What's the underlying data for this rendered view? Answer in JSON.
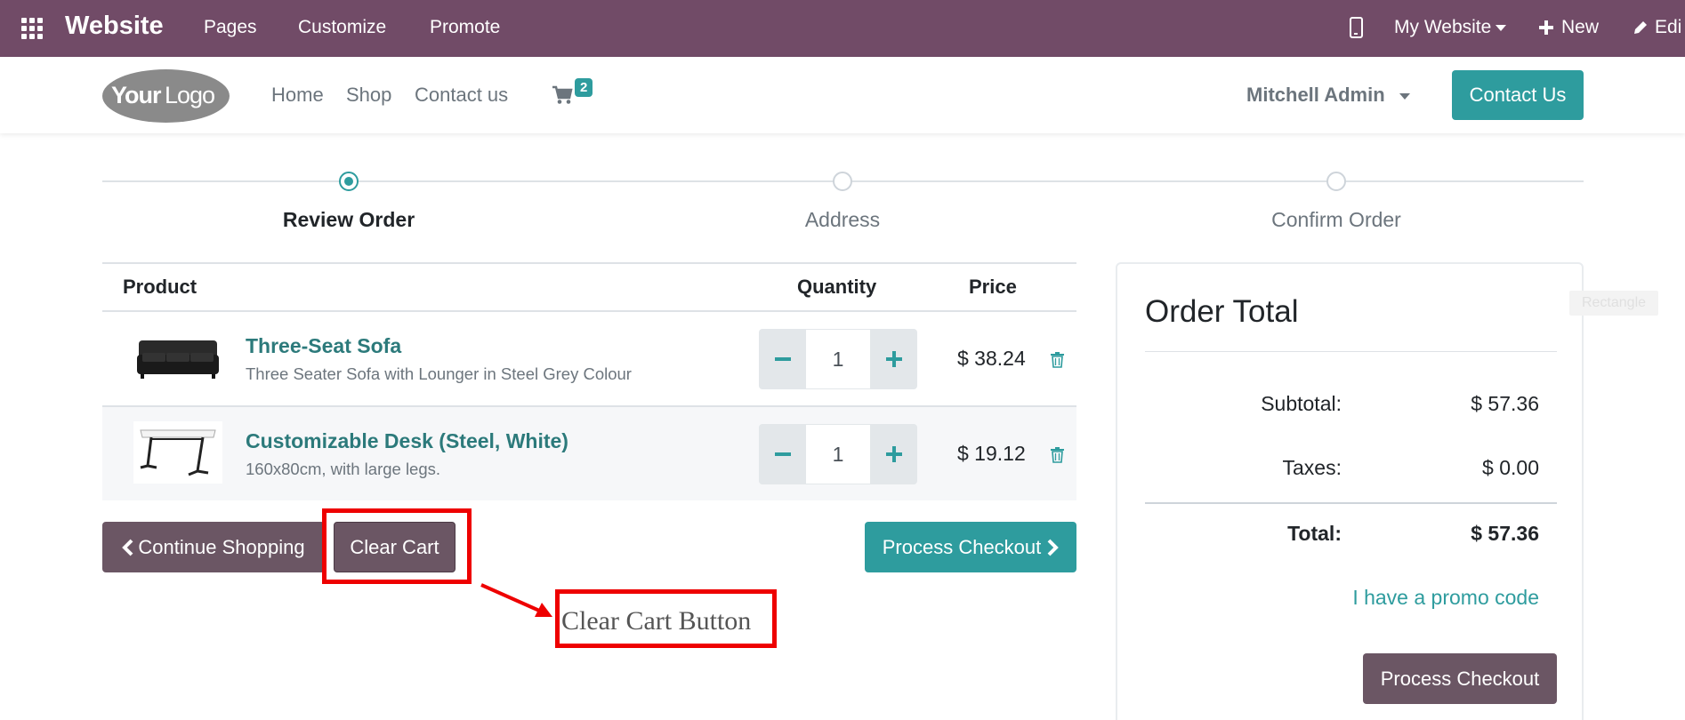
{
  "adminbar": {
    "app_name": "Website",
    "menu": [
      "Pages",
      "Customize",
      "Promote"
    ],
    "site_selector": "My Website",
    "new_label": "New",
    "edit_label": "Edi"
  },
  "header": {
    "logo_text_1": "Your",
    "logo_text_2": "Logo",
    "nav": [
      "Home",
      "Shop",
      "Contact us"
    ],
    "cart_count": "2",
    "user_name": "Mitchell Admin",
    "contact_button": "Contact Us"
  },
  "wizard": {
    "steps": [
      "Review Order",
      "Address",
      "Confirm Order"
    ],
    "active_step": 0
  },
  "cart": {
    "columns": {
      "product": "Product",
      "quantity": "Quantity",
      "price": "Price"
    },
    "items": [
      {
        "name": "Three-Seat Sofa",
        "description": "Three Seater Sofa with Lounger in Steel Grey Colour",
        "quantity": "1",
        "price": "$ 38.24"
      },
      {
        "name": "Customizable Desk (Steel, White)",
        "description": "160x80cm, with large legs.",
        "quantity": "1",
        "price": "$ 19.12"
      }
    ],
    "continue_label": "Continue Shopping",
    "clear_label": "Clear Cart",
    "checkout_label": "Process Checkout"
  },
  "annotation": {
    "text": "Clear Cart Button",
    "color": "#ee0000"
  },
  "order_total": {
    "title": "Order Total",
    "subtotal_label": "Subtotal:",
    "subtotal": "$ 57.36",
    "taxes_label": "Taxes:",
    "taxes": "$ 0.00",
    "total_label": "Total:",
    "total": "$ 57.36",
    "promo_link": "I have a promo code",
    "checkout_label": "Process Checkout"
  },
  "ghost_label": "Rectangle",
  "colors": {
    "adminbar": "#714b67",
    "primary": "#2e9c9e",
    "secondary": "#6b5664"
  }
}
